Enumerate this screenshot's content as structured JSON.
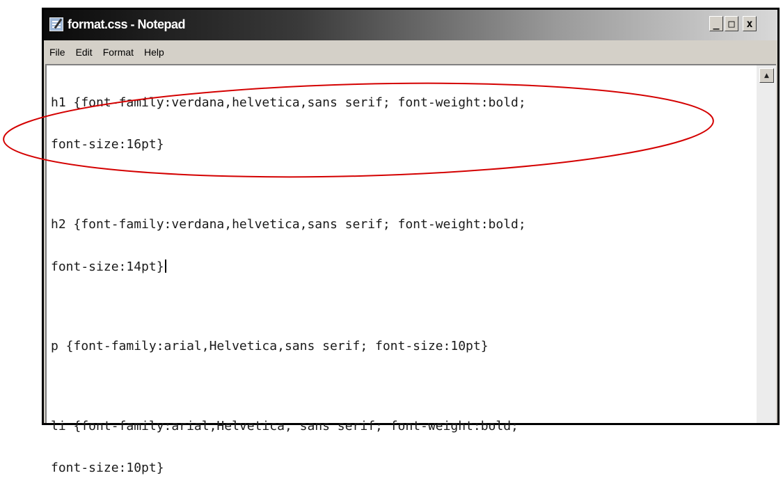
{
  "window": {
    "title": "format.css - Notepad",
    "controls": {
      "minimize": "_",
      "maximize": "□",
      "close": "x"
    }
  },
  "menu": {
    "items": [
      "File",
      "Edit",
      "Format",
      "Help"
    ]
  },
  "editor": {
    "lines": [
      "h1 {font-family:verdana,helvetica,sans serif; font-weight:bold;",
      "font-size:16pt}",
      "",
      "h2 {font-family:verdana,helvetica,sans serif; font-weight:bold;",
      "font-size:14pt}",
      "",
      "p {font-family:arial,Helvetica,sans serif; font-size:10pt}",
      "",
      "li {font-family:arial,Helvetica, sans serif; font-weight:bold;",
      "font-size:10pt}"
    ]
  },
  "scrollbar": {
    "up_arrow": "▲"
  },
  "annotation": {
    "ellipse_color": "#d40000"
  }
}
